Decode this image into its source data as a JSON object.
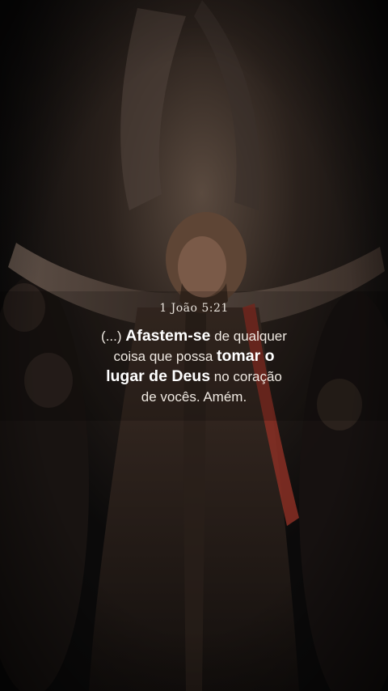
{
  "reference": "1 João 5:21",
  "verse": {
    "lines": [
      [
        {
          "t": "(...) ",
          "b": false
        },
        {
          "t": "Afastem-se",
          "b": true
        },
        {
          "t": " de qualquer",
          "b": false
        }
      ],
      [
        {
          "t": "coisa que possa ",
          "b": false
        },
        {
          "t": "tomar o",
          "b": true
        }
      ],
      [
        {
          "t": "lugar de Deus",
          "b": true
        },
        {
          "t": " no coração",
          "b": false
        }
      ],
      [
        {
          "t": "de vocês. Amém.",
          "b": false
        }
      ]
    ]
  },
  "colors": {
    "background": "#0b0a0a",
    "text": "#efe9e2",
    "robe": "#3a2a22",
    "sash": "#8a2f24"
  }
}
